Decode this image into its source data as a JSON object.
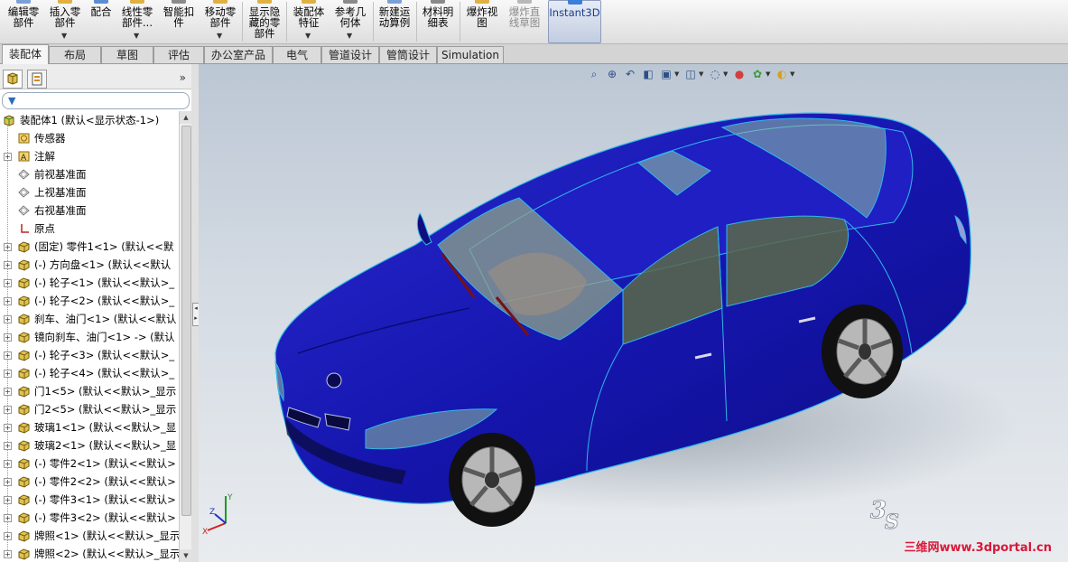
{
  "ribbon": {
    "buttons": [
      {
        "label": "编辑零\n部件",
        "icon": "edit-component-icon",
        "dropdown": false,
        "disabled": false
      },
      {
        "label": "插入零\n部件",
        "icon": "insert-component-icon",
        "dropdown": true,
        "disabled": false
      },
      {
        "label": "配合",
        "icon": "mate-icon",
        "dropdown": false,
        "disabled": false
      },
      {
        "label": "线性零\n部件...",
        "icon": "linear-pattern-icon",
        "dropdown": true,
        "disabled": false
      },
      {
        "label": "智能扣\n件",
        "icon": "smart-fasteners-icon",
        "dropdown": false,
        "disabled": false
      },
      {
        "label": "移动零\n部件",
        "icon": "move-component-icon",
        "dropdown": true,
        "disabled": false
      },
      {
        "label": "显示隐\n藏的零\n部件",
        "icon": "show-hidden-icon",
        "dropdown": false,
        "disabled": false
      },
      {
        "label": "装配体\n特征",
        "icon": "assembly-feature-icon",
        "dropdown": true,
        "disabled": false
      },
      {
        "label": "参考几\n何体",
        "icon": "reference-geometry-icon",
        "dropdown": true,
        "disabled": false
      },
      {
        "label": "新建运\n动算例",
        "icon": "new-motion-study-icon",
        "dropdown": false,
        "disabled": false
      },
      {
        "label": "材料明\n细表",
        "icon": "bom-icon",
        "dropdown": false,
        "disabled": false
      },
      {
        "label": "爆炸视\n图",
        "icon": "exploded-view-icon",
        "dropdown": false,
        "disabled": false
      },
      {
        "label": "爆炸直\n线草图",
        "icon": "explode-line-sketch-icon",
        "dropdown": false,
        "disabled": true
      },
      {
        "label": "Instant3D",
        "icon": "instant3d-icon",
        "dropdown": false,
        "disabled": false
      }
    ]
  },
  "tabs": [
    "装配体",
    "布局",
    "草图",
    "评估",
    "办公室产品",
    "电气",
    "管道设计",
    "管筒设计",
    "Simulation"
  ],
  "active_tab": "装配体",
  "panel": {
    "expand_label": "»",
    "filter_icon": "filter-icon"
  },
  "tree": [
    {
      "label": "装配体1 (默认<显示状态-1>)",
      "icon": "assembly-icon",
      "expander": false,
      "indent": 0
    },
    {
      "label": "传感器",
      "icon": "sensor-icon",
      "expander": false,
      "indent": 1
    },
    {
      "label": "注解",
      "icon": "annotation-icon",
      "expander": true,
      "indent": 1
    },
    {
      "label": "前视基准面",
      "icon": "plane-icon",
      "expander": false,
      "indent": 1
    },
    {
      "label": "上视基准面",
      "icon": "plane-icon",
      "expander": false,
      "indent": 1
    },
    {
      "label": "右视基准面",
      "icon": "plane-icon",
      "expander": false,
      "indent": 1
    },
    {
      "label": "原点",
      "icon": "origin-icon",
      "expander": false,
      "indent": 1
    },
    {
      "label": "(固定) 零件1<1> (默认<<默",
      "icon": "part-icon",
      "expander": true,
      "indent": 1
    },
    {
      "label": "(-) 方向盘<1> (默认<<默认",
      "icon": "part-icon",
      "expander": true,
      "indent": 1
    },
    {
      "label": "(-) 轮子<1> (默认<<默认>_",
      "icon": "part-icon",
      "expander": true,
      "indent": 1
    },
    {
      "label": "(-) 轮子<2> (默认<<默认>_",
      "icon": "part-icon",
      "expander": true,
      "indent": 1
    },
    {
      "label": "刹车、油门<1> (默认<<默认",
      "icon": "part-icon",
      "expander": true,
      "indent": 1
    },
    {
      "label": "镜向刹车、油门<1> -> (默认",
      "icon": "part-icon",
      "expander": true,
      "indent": 1
    },
    {
      "label": "(-) 轮子<3> (默认<<默认>_",
      "icon": "part-icon",
      "expander": true,
      "indent": 1
    },
    {
      "label": "(-) 轮子<4> (默认<<默认>_",
      "icon": "part-icon",
      "expander": true,
      "indent": 1
    },
    {
      "label": "门1<5> (默认<<默认>_显示",
      "icon": "part-icon",
      "expander": true,
      "indent": 1
    },
    {
      "label": "门2<5> (默认<<默认>_显示",
      "icon": "part-icon",
      "expander": true,
      "indent": 1
    },
    {
      "label": "玻璃1<1> (默认<<默认>_显",
      "icon": "part-icon",
      "expander": true,
      "indent": 1
    },
    {
      "label": "玻璃2<1> (默认<<默认>_显",
      "icon": "part-icon",
      "expander": true,
      "indent": 1
    },
    {
      "label": "(-) 零件2<1> (默认<<默认>",
      "icon": "part-icon",
      "expander": true,
      "indent": 1
    },
    {
      "label": "(-) 零件2<2> (默认<<默认>",
      "icon": "part-icon",
      "expander": true,
      "indent": 1
    },
    {
      "label": "(-) 零件3<1> (默认<<默认>",
      "icon": "part-icon",
      "expander": true,
      "indent": 1
    },
    {
      "label": "(-) 零件3<2> (默认<<默认>",
      "icon": "part-icon",
      "expander": true,
      "indent": 1
    },
    {
      "label": "牌照<1> (默认<<默认>_显示",
      "icon": "part-icon",
      "expander": true,
      "indent": 1
    },
    {
      "label": "牌照<2> (默认<<默认>_显示",
      "icon": "part-icon",
      "expander": true,
      "indent": 1
    }
  ],
  "headsup_toolbar": [
    {
      "icon": "zoom-to-fit-icon",
      "dropdown": false
    },
    {
      "icon": "zoom-to-area-icon",
      "dropdown": false
    },
    {
      "icon": "previous-view-icon",
      "dropdown": false
    },
    {
      "icon": "section-view-icon",
      "dropdown": false
    },
    {
      "icon": "view-orientation-icon",
      "dropdown": true
    },
    {
      "icon": "display-style-icon",
      "dropdown": true
    },
    {
      "icon": "hide-show-items-icon",
      "dropdown": true
    },
    {
      "icon": "edit-appearance-icon",
      "dropdown": false
    },
    {
      "icon": "apply-scene-icon",
      "dropdown": true
    },
    {
      "icon": "view-settings-icon",
      "dropdown": true
    }
  ],
  "triad": {
    "x": "X",
    "y": "Y",
    "z": "Z"
  },
  "watermark": {
    "logo": "3ds-logo",
    "text": "三维网www.3dportal.cn"
  },
  "colors": {
    "car_body": "#1a1ab4",
    "car_edge": "#2fb8e8",
    "glass": "#8fbfa0",
    "viewport_top": "#bcc7d4",
    "viewport_bottom": "#e9ecef",
    "watermark_text": "#d8183a"
  }
}
